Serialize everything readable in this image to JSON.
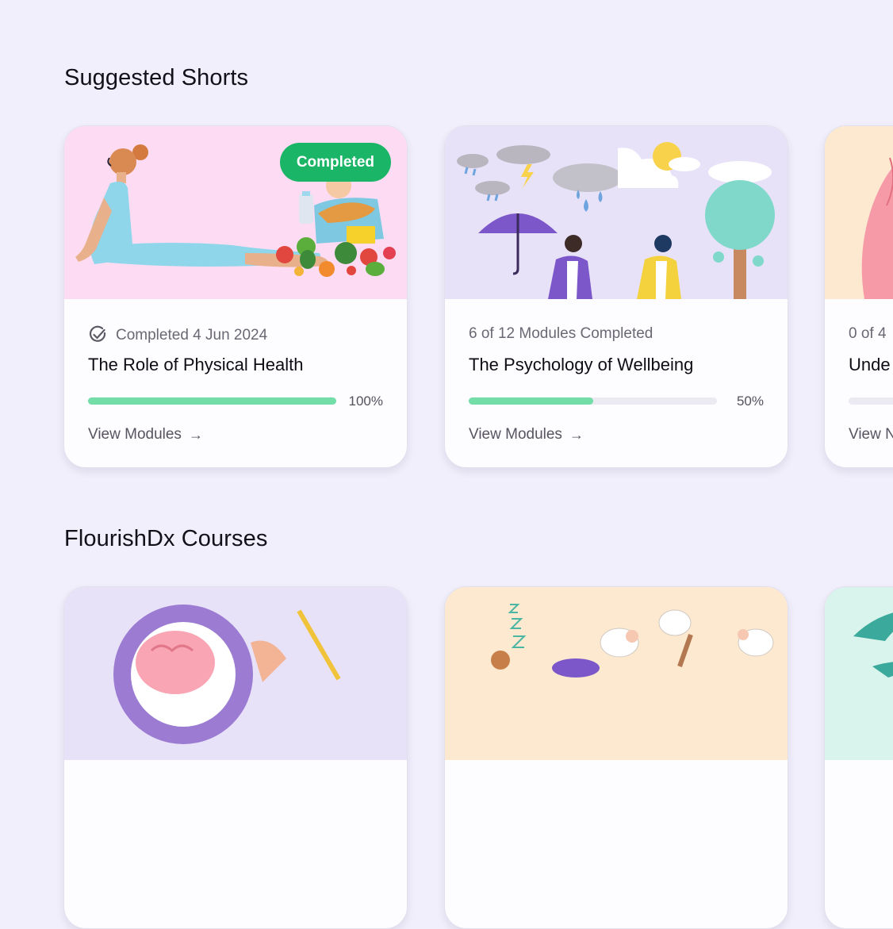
{
  "sections": [
    {
      "title": "Suggested Shorts"
    },
    {
      "title": "FlourishDx Courses"
    }
  ],
  "shorts": [
    {
      "badge": "Completed",
      "meta": "Completed 4 Jun 2024",
      "title": "The Role of Physical Health",
      "progress": 1.0,
      "progress_label": "100%",
      "link": "View Modules",
      "arrow": "→"
    },
    {
      "meta": "6 of 12 Modules Completed",
      "title": "The Psychology of Wellbeing",
      "progress": 0.5,
      "progress_label": "50%",
      "link": "View Modules",
      "arrow": "→"
    },
    {
      "meta": "0 of 4",
      "title": "Unde",
      "progress": 0,
      "link": "View N"
    }
  ],
  "colors": {
    "page_bg": "#f1effb",
    "badge_green": "#1bb567",
    "progress_green": "#72dda7",
    "hero_pink": "#fddcf3",
    "hero_lavender": "#e8e2f9",
    "hero_peach": "#fde8d0",
    "hero_mint": "#d9f4ec"
  }
}
